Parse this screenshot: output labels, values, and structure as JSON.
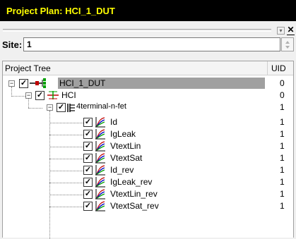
{
  "window": {
    "title": "Project Plan: HCI_1_DUT"
  },
  "site": {
    "label": "Site:",
    "value": "1"
  },
  "tree": {
    "columns": {
      "name": "Project Tree",
      "uid": "UID"
    },
    "rows": [
      {
        "label": "HCI_1_DUT",
        "uid": "0",
        "icon": "project-icon",
        "selected": true,
        "expanded": true,
        "checked": true
      },
      {
        "label": "HCI",
        "uid": "0",
        "icon": "test-icon",
        "expanded": true,
        "checked": true
      },
      {
        "label": "4terminal-n-fet",
        "uid": "1",
        "icon": "fet-icon",
        "expanded": true,
        "checked": true
      },
      {
        "label": "Id",
        "uid": "1",
        "icon": "measurement-icon",
        "checked": true
      },
      {
        "label": "IgLeak",
        "uid": "1",
        "icon": "measurement-icon",
        "checked": true
      },
      {
        "label": "VtextLin",
        "uid": "1",
        "icon": "measurement-icon",
        "checked": true
      },
      {
        "label": "VtextSat",
        "uid": "1",
        "icon": "measurement-icon",
        "checked": true
      },
      {
        "label": "Id_rev",
        "uid": "1",
        "icon": "measurement-icon",
        "checked": true
      },
      {
        "label": "IgLeak_rev",
        "uid": "1",
        "icon": "measurement-icon",
        "checked": true
      },
      {
        "label": "VtextLin_rev",
        "uid": "1",
        "icon": "measurement-icon",
        "checked": true
      },
      {
        "label": "VtextSat_rev",
        "uid": "1",
        "icon": "measurement-icon",
        "checked": true
      }
    ]
  },
  "colors": {
    "title_bg": "#000000",
    "title_fg": "#ffff00",
    "selection": "#a0a0a0"
  }
}
